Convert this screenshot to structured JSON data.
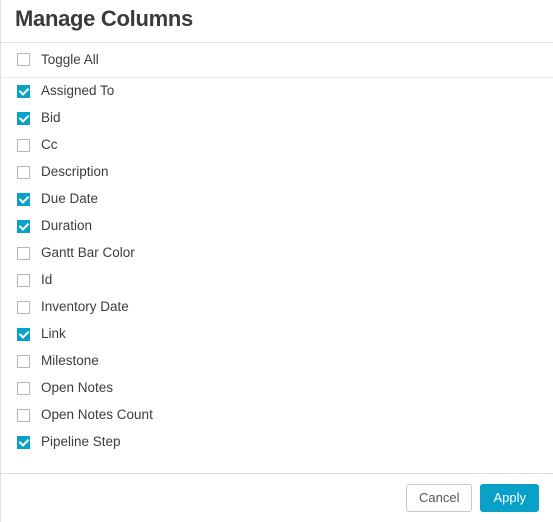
{
  "header": {
    "title": "Manage Columns"
  },
  "toggle_all": {
    "label": "Toggle All",
    "checked": false
  },
  "columns": [
    {
      "label": "Assigned To",
      "checked": true
    },
    {
      "label": "Bid",
      "checked": true
    },
    {
      "label": "Cc",
      "checked": false
    },
    {
      "label": "Description",
      "checked": false
    },
    {
      "label": "Due Date",
      "checked": true
    },
    {
      "label": "Duration",
      "checked": true
    },
    {
      "label": "Gantt Bar Color",
      "checked": false
    },
    {
      "label": "Id",
      "checked": false
    },
    {
      "label": "Inventory Date",
      "checked": false
    },
    {
      "label": "Link",
      "checked": true
    },
    {
      "label": "Milestone",
      "checked": false
    },
    {
      "label": "Open Notes",
      "checked": false
    },
    {
      "label": "Open Notes Count",
      "checked": false
    },
    {
      "label": "Pipeline Step",
      "checked": true
    }
  ],
  "footer": {
    "cancel_label": "Cancel",
    "apply_label": "Apply"
  }
}
